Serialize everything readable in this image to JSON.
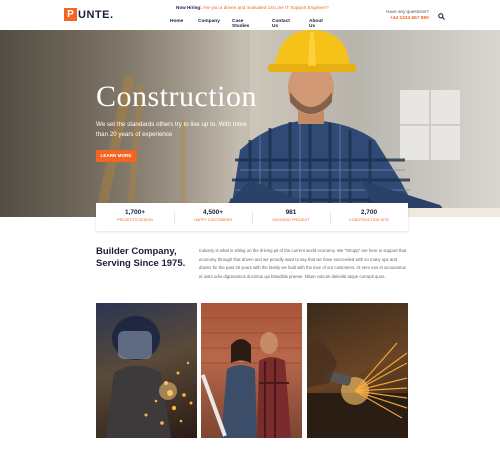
{
  "header": {
    "logo_letter": "P",
    "logo_rest": "UNTE.",
    "hiring_label": "Now Hiring:",
    "hiring_text": "Are you a driven and motivated 1st Line IT Support Engineer?",
    "nav": [
      "Home",
      "Company",
      "Case Studies",
      "Contact Us",
      "About Us"
    ],
    "questions": "Have any questions?",
    "phone": "+44 1234 567 890"
  },
  "hero": {
    "title": "Construction",
    "subtitle": "We set the standards others try to live up to. With more than 20 years of experience",
    "button": "LEARN MORE"
  },
  "stats": [
    {
      "value": "1,700+",
      "label": "PROJECTS DESIGN"
    },
    {
      "value": "4,500+",
      "label": "HAPPY CUSTOMERS"
    },
    {
      "value": "981",
      "label": "ONGOING PROJECT"
    },
    {
      "value": "2,700",
      "label": "CONSTRUCTION SITE"
    }
  ],
  "about": {
    "title_line1": "Builder Company,",
    "title_line2": "Serving Since 1975.",
    "text": "Industry is what is sitting on the driving pit of the current world economy. We \"Strupp\" are here to support that economy through that driven and we proudly want to say that we have succeeded with so many ups and downs for the past 25 years with the family we built with the love of our customers. At vero eos et accusamus et iusto odio dignissimos ducimus qui blanditiis praese. Nilum volcum delenitti atque corrupti quos."
  },
  "colors": {
    "accent": "#f26522",
    "navy": "#1a1f3c"
  },
  "icons": {
    "search": "search-icon"
  }
}
